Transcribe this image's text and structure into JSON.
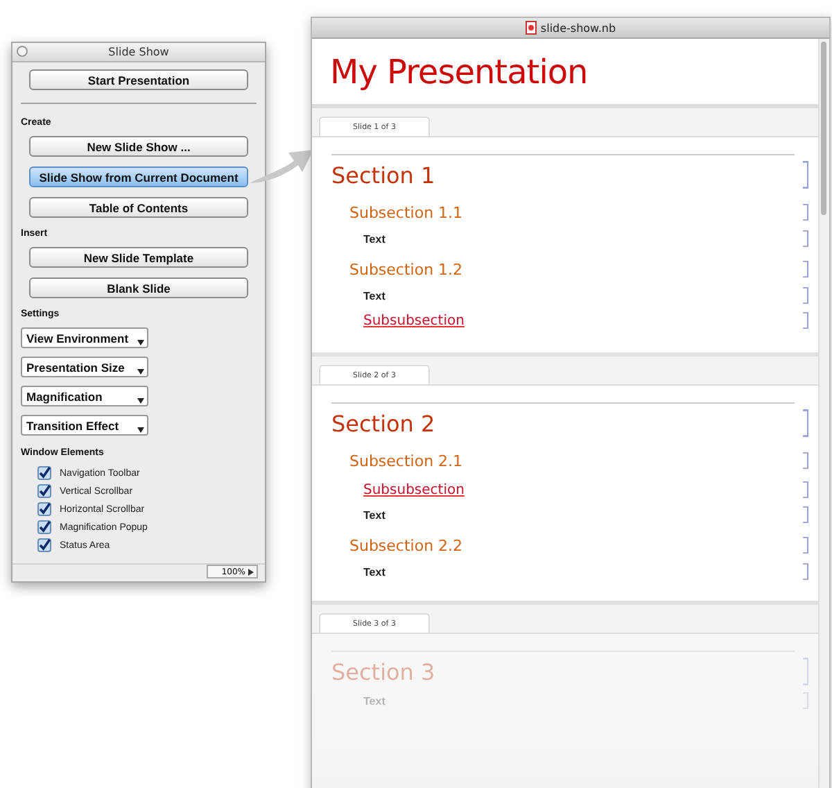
{
  "palette": {
    "title": "Slide Show",
    "top_button": {
      "label": "Start Presentation",
      "selected": false
    },
    "groups": [
      {
        "heading": "Create",
        "kind": "buttons",
        "items": [
          {
            "label": "New Slide Show ...",
            "selected": false
          },
          {
            "label": "Slide Show from Current Document",
            "selected": true
          },
          {
            "label": "Table of Contents",
            "selected": false
          }
        ]
      },
      {
        "heading": "Insert",
        "kind": "buttons",
        "items": [
          {
            "label": "New Slide Template",
            "selected": false
          },
          {
            "label": "Blank Slide",
            "selected": false
          }
        ]
      },
      {
        "heading": "Settings",
        "kind": "menus",
        "items": [
          {
            "label": "View Environment"
          },
          {
            "label": "Presentation Size"
          },
          {
            "label": "Magnification"
          },
          {
            "label": "Transition Effect"
          }
        ]
      },
      {
        "heading": "Window Elements",
        "kind": "checkboxes",
        "items": [
          {
            "label": "Navigation Toolbar",
            "checked": true
          },
          {
            "label": "Vertical Scrollbar",
            "checked": true
          },
          {
            "label": "Horizontal Scrollbar",
            "checked": true
          },
          {
            "label": "Magnification Popup",
            "checked": true
          },
          {
            "label": "Status Area",
            "checked": true
          }
        ]
      }
    ],
    "zoom": "100%"
  },
  "notebook": {
    "title": "slide-show.nb",
    "heading": "My Presentation",
    "slides": [
      {
        "tab": "Slide 1 of 3",
        "faded": false,
        "cells": [
          {
            "kind": "section",
            "text": "Section 1"
          },
          {
            "kind": "subsection",
            "text": "Subsection 1.1"
          },
          {
            "kind": "text",
            "text": "Text"
          },
          {
            "kind": "subsection",
            "text": "Subsection 1.2"
          },
          {
            "kind": "text",
            "text": "Text"
          },
          {
            "kind": "subsubsection",
            "text": "Subsubsection"
          }
        ]
      },
      {
        "tab": "Slide 2 of 3",
        "faded": false,
        "cells": [
          {
            "kind": "section",
            "text": "Section 2"
          },
          {
            "kind": "subsection",
            "text": "Subsection 2.1"
          },
          {
            "kind": "subsubsection",
            "text": "Subsubsection"
          },
          {
            "kind": "text",
            "text": "Text"
          },
          {
            "kind": "subsection",
            "text": "Subsection 2.2"
          },
          {
            "kind": "text",
            "text": "Text"
          }
        ]
      },
      {
        "tab": "Slide 3 of 3",
        "faded": true,
        "cells": [
          {
            "kind": "section",
            "text": "Section 3"
          },
          {
            "kind": "text",
            "text": "Text"
          }
        ]
      }
    ]
  }
}
